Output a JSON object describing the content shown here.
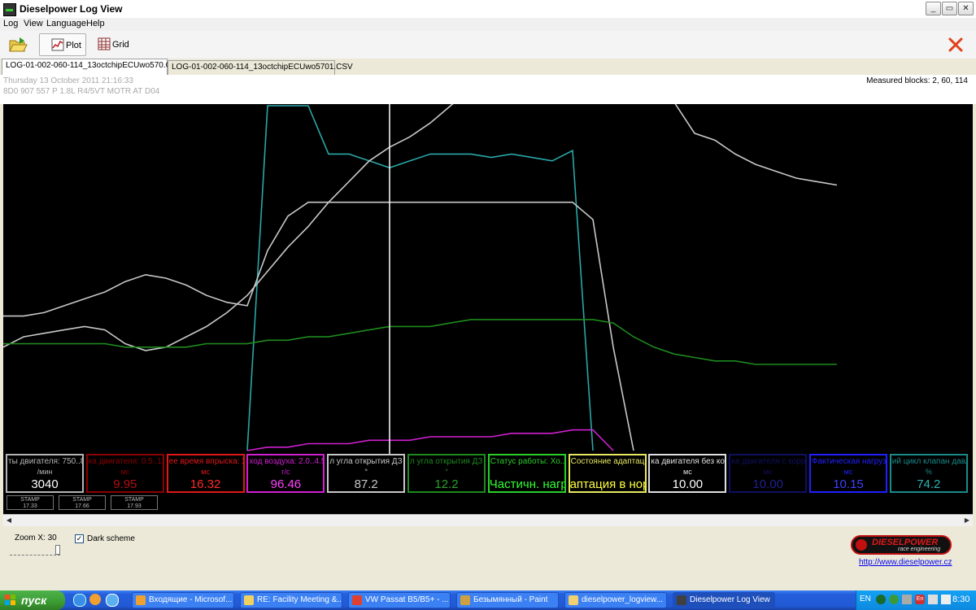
{
  "window": {
    "title": "Dieselpower Log View",
    "buttons": [
      "_",
      "▭",
      "✕"
    ]
  },
  "menu": [
    "Log",
    "View",
    "Language",
    "Help"
  ],
  "toolbar": {
    "plot_label": "Plot",
    "grid_label": "Grid"
  },
  "tabs": [
    {
      "label": "LOG-01-002-060-114_13octchipECUwo570.CSV",
      "active": true
    },
    {
      "label": "LOG-01-002-060-114_13octchipECUwo5701.CSV",
      "active": false
    }
  ],
  "info": {
    "date": "Thursday 13 October 2011 21:16:33",
    "model": "8D0 907 557 P  1.8L R4/5VT MOTR AT D04",
    "measured_blocks": "Measured blocks: 2, 60, 114"
  },
  "channels": [
    {
      "name": "ты двигателя: 750..85",
      "unit": "/мин",
      "value": "3040",
      "color": "#b4b4b4",
      "value_color": "#ffffff"
    },
    {
      "name": "ка двигателя: 0.5..1",
      "unit": "мс",
      "value": "9.95",
      "color": "#8b0000",
      "value_color": "#b01010"
    },
    {
      "name": "ее время впрыска: 2",
      "unit": "мс",
      "value": "16.32",
      "color": "#e01818",
      "value_color": "#ff2a2a"
    },
    {
      "name": "ход воздуха: 2.0..4.5",
      "unit": "г/с",
      "value": "96.46",
      "color": "#d020d0",
      "value_color": "#ff40ff"
    },
    {
      "name": "л угла открытия ДЗ 1",
      "unit": "°",
      "value": "87.2",
      "color": "#c8c8c8",
      "value_color": "#c8c8c8"
    },
    {
      "name": "л угла открытия ДЗ 2",
      "unit": "°",
      "value": "12.2",
      "color": "#1e8a1e",
      "value_color": "#2aa22a"
    },
    {
      "name": "Статус работы: Хо...",
      "unit": "",
      "value": "Частичн. нагр",
      "color": "#28d028",
      "value_color": "#30ff30"
    },
    {
      "name": "Состояние адаптац...",
      "unit": "",
      "value": "аптация в нор",
      "color": "#e8e860",
      "value_color": "#ffff40"
    },
    {
      "name": "ка двигателя без корр",
      "unit": "мс",
      "value": "10.00",
      "color": "#e0e0e0",
      "value_color": "#ffffff"
    },
    {
      "name": "ка двигателя с коррек",
      "unit": "мс",
      "value": "10.00",
      "color": "#101060",
      "value_color": "#202090"
    },
    {
      "name": "Фактическая нагрузка",
      "unit": "мс",
      "value": "10.15",
      "color": "#2020ff",
      "value_color": "#4040ff"
    },
    {
      "name": "ий цикл клапан давлен",
      "unit": "%",
      "value": "74.2",
      "color": "#1a8a8a",
      "value_color": "#30b0b0"
    }
  ],
  "stamps": [
    {
      "label": "STAMP",
      "value": "17.33"
    },
    {
      "label": "STAMP",
      "value": "17.66"
    },
    {
      "label": "STAMP",
      "value": "17.93"
    }
  ],
  "chart_data": {
    "type": "line",
    "x": [
      0,
      1,
      2,
      3,
      4,
      5,
      6,
      7,
      8,
      9,
      10,
      11,
      12,
      13,
      14,
      15,
      16,
      17,
      18,
      19,
      20,
      21,
      22,
      23,
      24,
      25,
      26,
      27,
      28,
      29,
      30,
      31,
      32,
      33,
      34,
      35,
      36,
      37,
      38,
      39,
      40,
      41
    ],
    "cursor_x": 19,
    "series": [
      {
        "color": "#2aa7a7",
        "values": [
          null,
          null,
          null,
          null,
          null,
          null,
          null,
          null,
          null,
          null,
          null,
          null,
          0,
          100,
          100,
          100,
          86,
          86,
          84,
          82,
          84,
          86,
          86,
          86,
          85,
          86,
          85,
          84,
          87,
          0,
          null,
          null,
          null,
          null,
          null,
          null,
          null,
          null,
          null,
          null,
          null,
          null
        ]
      },
      {
        "color": "#c8c8c8",
        "values": [
          30,
          33,
          34,
          35,
          36,
          35,
          31,
          29,
          30,
          33,
          36,
          40,
          45,
          52,
          59,
          65,
          72,
          78,
          84,
          88,
          91,
          95,
          100,
          105,
          108,
          112,
          116,
          121,
          128,
          139,
          141,
          137,
          116,
          101,
          92,
          90,
          86,
          83,
          81,
          79,
          78,
          77
        ]
      },
      {
        "color": "#c8c8c8",
        "values": [
          39,
          39,
          40,
          42,
          44,
          46,
          49,
          51,
          50,
          48,
          45,
          43,
          42,
          58,
          68,
          72,
          72,
          72,
          72,
          72,
          72,
          72,
          72,
          72,
          72,
          72,
          72,
          72,
          72,
          67,
          30,
          0,
          null,
          null,
          null,
          null,
          null,
          null,
          null,
          null,
          null,
          null
        ]
      },
      {
        "color": "#1e8a1e",
        "values": [
          31,
          31,
          31,
          31,
          31,
          31,
          30,
          30,
          30,
          30,
          31,
          31,
          31,
          32,
          32,
          33,
          33,
          34,
          35,
          36,
          36,
          36,
          37,
          38,
          38,
          38,
          38,
          38,
          38,
          38,
          37,
          33,
          30,
          28,
          27,
          26,
          26,
          25,
          25,
          25,
          25,
          25
        ]
      },
      {
        "color": "#d020d0",
        "values": [
          null,
          null,
          null,
          null,
          null,
          null,
          null,
          null,
          null,
          null,
          null,
          null,
          0,
          1,
          1,
          2,
          2,
          2,
          3,
          3,
          3,
          4,
          4,
          4,
          4,
          5,
          5,
          5,
          6,
          6,
          0,
          null,
          null,
          null,
          null,
          null,
          null,
          null,
          null,
          null,
          null,
          null
        ]
      }
    ]
  },
  "zoom": {
    "label": "Zoom X: 30"
  },
  "dark_scheme": {
    "label": "Dark scheme",
    "checked": true
  },
  "logo": {
    "title": "DIESELPOWER",
    "subtitle": "race engineering",
    "url": "http://www.dieselpower.cz"
  },
  "taskbar": {
    "start": "пуск",
    "tasks": [
      {
        "label": "Входящие - Microsof...",
        "color": "#f0a030"
      },
      {
        "label": "RE: Facility Meeting &...",
        "color": "#f0d060"
      },
      {
        "label": "VW Passat B5/B5+ - ...",
        "color": "#e04030"
      },
      {
        "label": "Безымянный - Paint",
        "color": "#d0a040"
      },
      {
        "label": "dieselpower_logview...",
        "color": "#f0d070"
      },
      {
        "label": "Dieselpower Log View",
        "color": "#404040"
      }
    ],
    "lang": "EN",
    "clock": "8:30"
  }
}
